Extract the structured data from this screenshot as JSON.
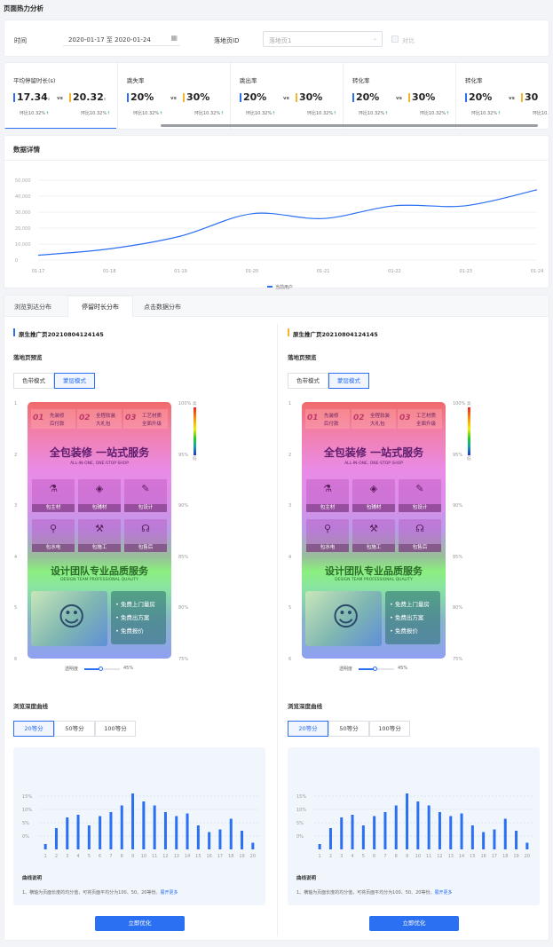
{
  "page_title": "页面热力分析",
  "filter": {
    "time_label": "时间",
    "date_range": "2020-01-17 至 2020-01-24",
    "landing_label": "落地页ID",
    "landing_placeholder": "落地页1",
    "compare_label": "对比"
  },
  "kpis": [
    {
      "title": "平均停留时长(s)",
      "v1": "17.34",
      "u1": "s",
      "vs": "vs",
      "v2": "20.32",
      "u2": "s",
      "c1": "环比10.32%",
      "c2": "环比10.32%"
    },
    {
      "title": "跳失率",
      "v1": "20%",
      "u1": "",
      "vs": "vs",
      "v2": "30%",
      "u2": "",
      "c1": "环比10.32%",
      "c2": "环比10.32%"
    },
    {
      "title": "跳出率",
      "v1": "20%",
      "u1": "",
      "vs": "vs",
      "v2": "30%",
      "u2": "",
      "c1": "环比10.32%",
      "c2": "环比10.32%"
    },
    {
      "title": "转化率",
      "v1": "20%",
      "u1": "",
      "vs": "vs",
      "v2": "30%",
      "u2": "",
      "c1": "环比10.32%",
      "c2": "环比10.32%"
    },
    {
      "title": "转化率",
      "v1": "20%",
      "u1": "",
      "vs": "vs",
      "v2": "30",
      "u2": "",
      "c1": "环比10.32%",
      "c2": "环比10."
    }
  ],
  "colors": {
    "primary": "#2b6ff2",
    "compare": "#f7b52c",
    "up": "#17b26a"
  },
  "detail": {
    "title": "数据详情",
    "legend": "当前用户",
    "chart_data": {
      "type": "line",
      "x": [
        "01-17",
        "01-18",
        "01-19",
        "01-20",
        "01-21",
        "01-22",
        "01-23",
        "01-24"
      ],
      "ylim": [
        0,
        50000
      ],
      "yticks": [
        "50,000",
        "40,000",
        "30,000",
        "20,000",
        "10,000",
        "0"
      ],
      "series": [
        {
          "name": "当前用户",
          "values": [
            3000,
            7000,
            15000,
            29000,
            26000,
            34000,
            34000,
            44000
          ]
        }
      ]
    }
  },
  "tabs": [
    "浏览到达分布",
    "停留时长分布",
    "点击数据分布"
  ],
  "panels": [
    {
      "id": "原生推广页20210804124145",
      "accent": "#2b6ff2"
    },
    {
      "id": "原生推广页20210804124145",
      "accent": "#f7b52c"
    }
  ],
  "preview": {
    "title": "落地页预览",
    "mode1": "色带模式",
    "mode2": "蒙层模式",
    "left_axis": [
      "1",
      "2",
      "3",
      "4",
      "5",
      "6"
    ],
    "right_axis": [
      "100%",
      "95%",
      "90%",
      "85%",
      "80%",
      "75%"
    ],
    "legend_high": "高",
    "legend_low": "低",
    "opacity_label": "透明度",
    "opacity_value": "45%",
    "page": {
      "b1": [
        "01",
        "先装修",
        "后付款"
      ],
      "b2": [
        "02",
        "全程软装",
        "大礼包"
      ],
      "b3": [
        "03",
        "工艺材质",
        "全面升级"
      ],
      "headline": "全包装修 一站式服务",
      "sub": "ALL-IN-ONE, ONE-STOP SHOP",
      "services": [
        "包主材",
        "包辅材",
        "包设计",
        "包水电",
        "包施工",
        "包售后"
      ],
      "team": "设计团队专业品质服务",
      "team_sub": "DESIGN TEAM PROFESSIONAL QUALITY",
      "perks": [
        "免费上门量房",
        "免费出方案",
        "免费报价"
      ]
    }
  },
  "depth": {
    "title": "浏览深度曲线",
    "options": [
      "20等分",
      "50等分",
      "100等分"
    ],
    "note_title": "曲线说明",
    "note": "1、横轴为页面长度的均分值，可将页面平均分为100、50、20等份。",
    "expand": "展开更多",
    "button": "立即优化",
    "chart_data": {
      "type": "bar",
      "categories": [
        "1",
        "2",
        "3",
        "4",
        "5",
        "6",
        "7",
        "8",
        "9",
        "10",
        "11",
        "12",
        "13",
        "14",
        "15",
        "16",
        "17",
        "18",
        "19",
        "20"
      ],
      "values": [
        -3,
        3,
        7,
        8,
        4,
        7.5,
        9,
        11.5,
        16,
        13,
        11.5,
        9,
        7.5,
        8.5,
        4,
        1.5,
        2.5,
        6.5,
        2,
        -2.5
      ],
      "yticks": [
        "15%",
        "10%",
        "5%",
        "0%"
      ],
      "ylim": [
        -5,
        20
      ]
    }
  }
}
